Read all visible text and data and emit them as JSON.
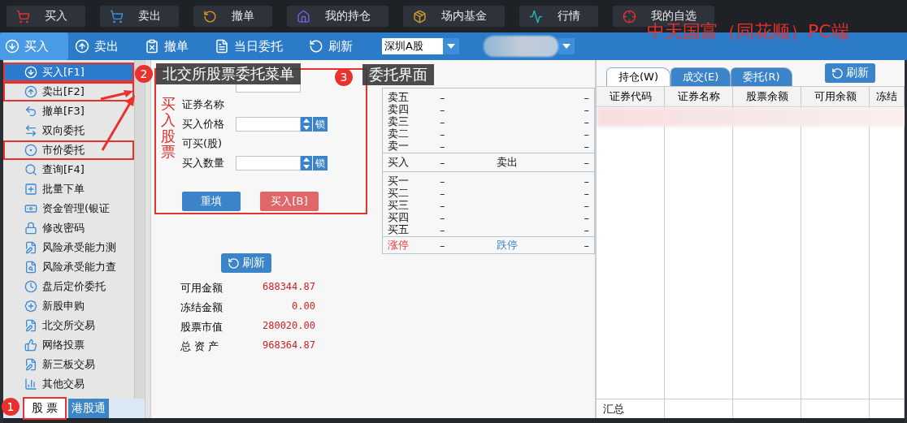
{
  "top_toolbar": [
    {
      "label": "买入"
    },
    {
      "label": "卖出"
    },
    {
      "label": "撤单"
    },
    {
      "label": "我的持仓"
    },
    {
      "label": "场内基金"
    },
    {
      "label": "行情"
    },
    {
      "label": "我的自选"
    }
  ],
  "annotation_title": "中天国富（同花顺）PC端",
  "action_bar": {
    "items": [
      {
        "label": "买入",
        "selected": true
      },
      {
        "label": "卖出",
        "selected": false
      },
      {
        "label": "撤单",
        "selected": false
      },
      {
        "label": "当日委托",
        "selected": false
      },
      {
        "label": "刷新",
        "selected": false
      }
    ],
    "market_select": {
      "value": "深圳A股"
    }
  },
  "sidebar": {
    "items": [
      {
        "label": "买入[F1]",
        "selected": true,
        "boxed": true
      },
      {
        "label": "卖出[F2]",
        "selected": false,
        "boxed": true
      },
      {
        "label": "撤单[F3]",
        "selected": false,
        "boxed": false
      },
      {
        "label": "双向委托",
        "selected": false,
        "boxed": false
      },
      {
        "label": "市价委托",
        "selected": false,
        "boxed": true
      },
      {
        "label": "查询[F4]",
        "selected": false,
        "boxed": false
      },
      {
        "label": "批量下单",
        "selected": false,
        "boxed": false
      },
      {
        "label": "资金管理(银证",
        "selected": false,
        "boxed": false
      },
      {
        "label": "修改密码",
        "selected": false,
        "boxed": false
      },
      {
        "label": "风险承受能力测",
        "selected": false,
        "boxed": false
      },
      {
        "label": "风险承受能力查",
        "selected": false,
        "boxed": false
      },
      {
        "label": "盘后定价委托",
        "selected": false,
        "boxed": false
      },
      {
        "label": "新股申购",
        "selected": false,
        "boxed": false
      },
      {
        "label": "北交所交易",
        "selected": false,
        "boxed": false
      },
      {
        "label": "网络投票",
        "selected": false,
        "boxed": false
      },
      {
        "label": "新三板交易",
        "selected": false,
        "boxed": false
      },
      {
        "label": "其他交易",
        "selected": false,
        "boxed": false
      }
    ],
    "tabs": [
      {
        "label": "股 票",
        "selected": true,
        "boxed": true
      },
      {
        "label": "港股通",
        "selected": false,
        "boxed": false
      }
    ]
  },
  "callouts": [
    {
      "number": "1"
    },
    {
      "number": "2",
      "text": "北交所股票委托菜单"
    },
    {
      "number": "3",
      "text": "委托界面"
    }
  ],
  "order_form": {
    "title": "买入股票",
    "boxed": true,
    "fields": [
      {
        "kind": "input"
      },
      {
        "kind": "text",
        "label": "证券名称"
      },
      {
        "kind": "spin",
        "label": "买入价格",
        "lock": "锁"
      },
      {
        "kind": "text",
        "label": "可买(股)"
      },
      {
        "kind": "spin",
        "label": "买入数量",
        "lock": "锁"
      }
    ],
    "buttons": [
      {
        "label": "重填",
        "kind": "primary"
      },
      {
        "label": "买入[B]",
        "kind": "danger"
      }
    ]
  },
  "funds": {
    "refresh": "刷新",
    "rows": [
      {
        "label": "可用金额",
        "value": "688344.87"
      },
      {
        "label": "冻结金额",
        "value": "0.00"
      },
      {
        "label": "股票市值",
        "value": "280020.00"
      },
      {
        "label": "总 资 产",
        "value": "968364.87"
      }
    ]
  },
  "quote": {
    "sell_rows": [
      {
        "label": "卖五",
        "price": "–",
        "volume": "–"
      },
      {
        "label": "卖四",
        "price": "–",
        "volume": "–"
      },
      {
        "label": "卖三",
        "price": "–",
        "volume": "–"
      },
      {
        "label": "卖二",
        "price": "–",
        "volume": "–"
      },
      {
        "label": "卖一",
        "price": "–",
        "volume": "–"
      }
    ],
    "middle": {
      "buy_label": "买入",
      "buy_value": "–",
      "sell_label": "卖出",
      "sell_value": "–"
    },
    "buy_rows": [
      {
        "label": "买一",
        "price": "–",
        "volume": "–"
      },
      {
        "label": "买二",
        "price": "–",
        "volume": "–"
      },
      {
        "label": "买三",
        "price": "–",
        "volume": "–"
      },
      {
        "label": "买四",
        "price": "–",
        "volume": "–"
      },
      {
        "label": "买五",
        "price": "–",
        "volume": "–"
      }
    ],
    "limits": {
      "up_label": "涨停",
      "up_value": "–",
      "down_label": "跌停",
      "down_value": "–"
    }
  },
  "positions": {
    "tabs": [
      {
        "label": "持仓(W)",
        "selected": true
      },
      {
        "label": "成交(E)",
        "selected": false
      },
      {
        "label": "委托(R)",
        "selected": false
      }
    ],
    "refresh": "刷新",
    "columns": [
      "证券代码",
      "证券名称",
      "股票余额",
      "可用余额",
      "冻结"
    ],
    "footer": "汇总"
  }
}
